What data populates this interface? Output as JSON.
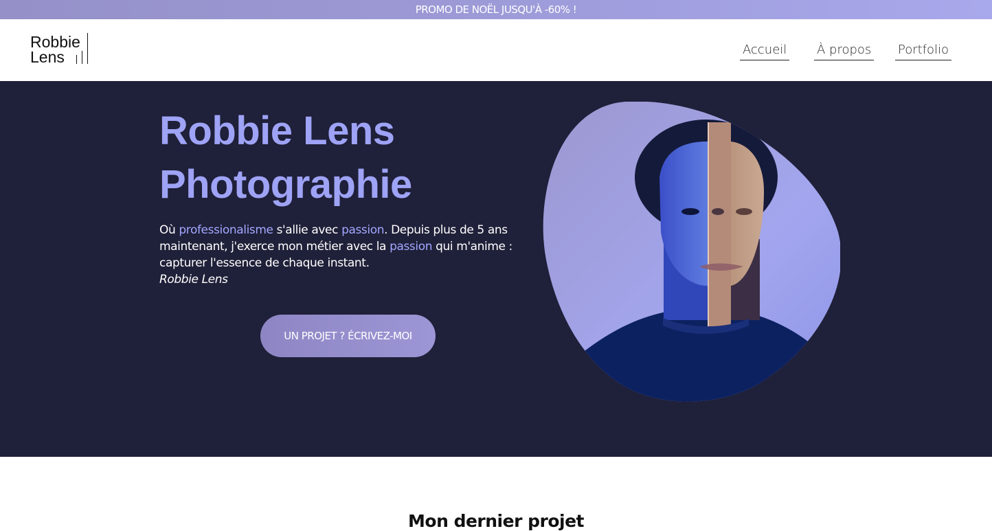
{
  "promo": {
    "text": "PROMO DE NOËL JUSQU'À -60% !"
  },
  "logo": {
    "line1": "Robbie",
    "line2": "Lens"
  },
  "nav": {
    "items": [
      {
        "label": "Accueil"
      },
      {
        "label": "À propos"
      },
      {
        "label": "Portfolio"
      }
    ]
  },
  "hero": {
    "title_line1": "Robbie Lens",
    "title_line2": "Photographie",
    "intro_1": "Où ",
    "highlight_1": "professionalisme",
    "intro_2": " s'allie avec ",
    "highlight_2": "passion",
    "intro_3": ". Depuis plus de 5 ans maintenant, j'exerce mon métier avec la ",
    "highlight_3": "passion",
    "intro_4": " qui m'anime : capturer l'essence de chaque instant.",
    "signature": "Robbie Lens",
    "cta_label": "UN PROJET ? ÉCRIVEZ-MOI"
  },
  "section": {
    "title": "Mon dernier projet"
  },
  "colors": {
    "hero_background": "#1f2039",
    "accent": "#9ea3f6",
    "highlight": "#a3a7ff",
    "promo_bar": "#9c99d6"
  },
  "icons": {
    "portrait_image": "portrait-image"
  }
}
